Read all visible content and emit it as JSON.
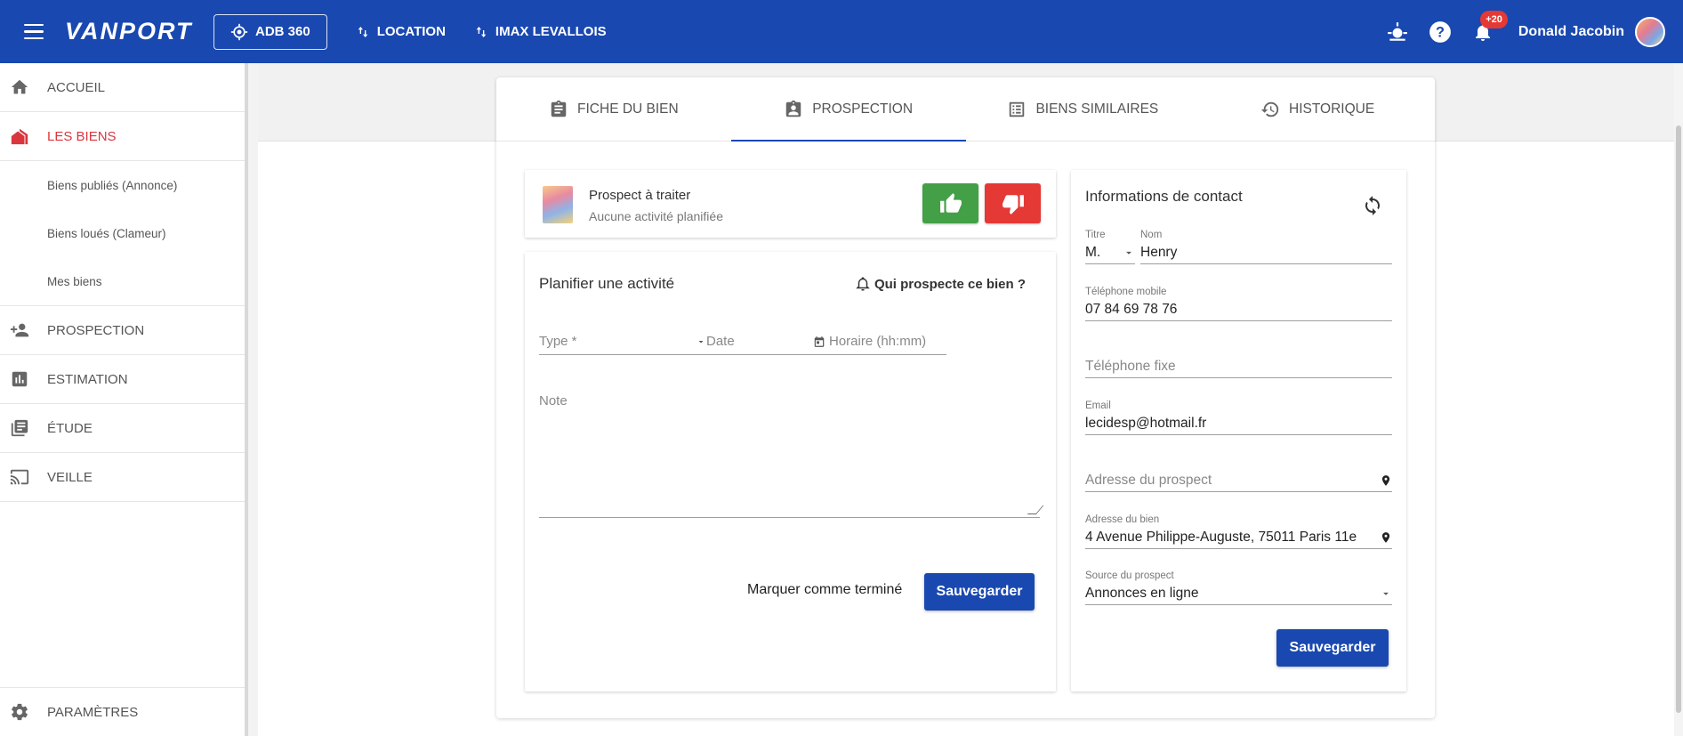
{
  "topbar": {
    "logo": "VANPORT",
    "adb_button": "ADB 360",
    "location_link": "LOCATION",
    "agency_link": "IMAX LEVALLOIS",
    "notification_count": "+20",
    "user_name": "Donald Jacobin"
  },
  "sidebar": {
    "items": [
      {
        "label": "ACCUEIL",
        "icon": "home-icon"
      },
      {
        "label": "LES BIENS",
        "icon": "buildings-icon"
      },
      {
        "label": "PROSPECTION",
        "icon": "person-add-icon"
      },
      {
        "label": "ESTIMATION",
        "icon": "bar-chart-icon"
      },
      {
        "label": "ÉTUDE",
        "icon": "library-books-icon"
      },
      {
        "label": "VEILLE",
        "icon": "cast-icon"
      }
    ],
    "sub_items": [
      "Biens publiés (Annonce)",
      "Biens loués (Clameur)",
      "Mes biens"
    ],
    "settings": "PARAMÈTRES"
  },
  "tabs": [
    {
      "label": "FICHE DU BIEN"
    },
    {
      "label": "PROSPECTION"
    },
    {
      "label": "BIENS SIMILAIRES"
    },
    {
      "label": "HISTORIQUE"
    }
  ],
  "prospect": {
    "title": "Prospect à traiter",
    "subtitle": "Aucune activité planifiée"
  },
  "plan": {
    "title": "Planifier une activité",
    "qui_link": "Qui prospecte ce bien ?",
    "type_placeholder": "Type *",
    "date_placeholder": "Date",
    "horaire_placeholder": "Horaire (hh:mm)",
    "note_placeholder": "Note",
    "mark_done": "Marquer comme terminé",
    "save": "Sauvegarder"
  },
  "contact": {
    "title": "Informations de contact",
    "titre_label": "Titre",
    "titre_value": "M.",
    "nom_label": "Nom",
    "nom_value": "Henry",
    "mobile_label": "Téléphone mobile",
    "mobile_value": "07 84 69 78 76",
    "fixe_placeholder": "Téléphone fixe",
    "email_label": "Email",
    "email_value": "lecidesp@hotmail.fr",
    "adresse_prospect_placeholder": "Adresse du prospect",
    "adresse_bien_label": "Adresse du bien",
    "adresse_bien_value": "4 Avenue Philippe-Auguste, 75011 Paris 11e",
    "source_label": "Source du prospect",
    "source_value": "Annonces en ligne",
    "save": "Sauvegarder"
  },
  "colors": {
    "primary": "#1948b0",
    "accent_red": "#d9363e",
    "thumb_up": "#43a047",
    "thumb_down": "#e53935"
  }
}
